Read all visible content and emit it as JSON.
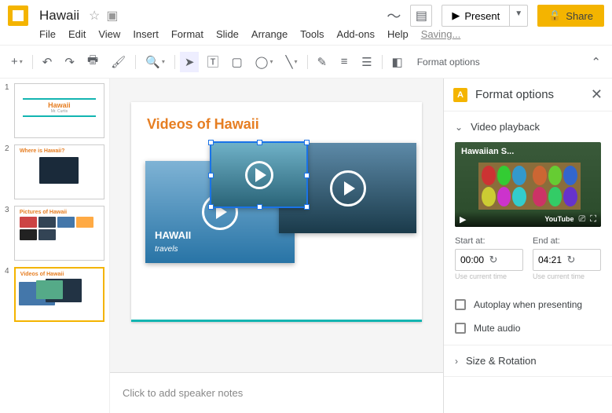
{
  "doc": {
    "title": "Hawaii",
    "saving": "Saving..."
  },
  "menus": {
    "file": "File",
    "edit": "Edit",
    "view": "View",
    "insert": "Insert",
    "format": "Format",
    "slide": "Slide",
    "arrange": "Arrange",
    "tools": "Tools",
    "addons": "Add-ons",
    "help": "Help"
  },
  "titlebar": {
    "present": "Present",
    "share": "Share"
  },
  "toolbar": {
    "format_options": "Format options"
  },
  "thumbs": {
    "n1": "1",
    "n2": "2",
    "n3": "3",
    "n4": "4",
    "s1_title": "Hawaii",
    "s1_sub": "Mr. Curtis",
    "s2_title": "Where is Hawaii?",
    "s3_title": "Pictures of Hawaii",
    "s4_title": "Videos of Hawaii"
  },
  "slide": {
    "title": "Videos of Hawaii",
    "v1_sub": "travels"
  },
  "notes": {
    "placeholder": "Click to add speaker notes"
  },
  "panel": {
    "title": "Format options",
    "section_video": "Video playback",
    "preview_title": "Hawaiian S...",
    "youtube": "YouTube",
    "start_label": "Start at:",
    "end_label": "End at:",
    "start_value": "00:00",
    "end_value": "04:21",
    "hint": "Use current time",
    "autoplay": "Autoplay when presenting",
    "mute": "Mute audio",
    "section_size": "Size & Rotation"
  }
}
